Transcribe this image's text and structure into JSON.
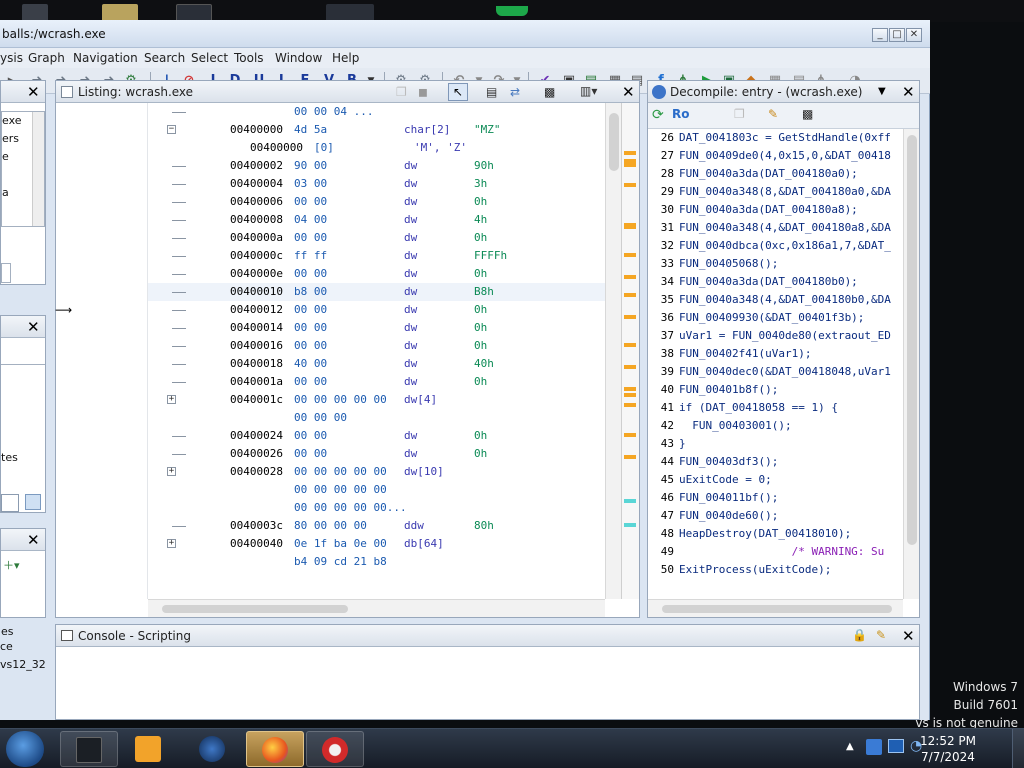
{
  "window": {
    "title": "balls:/wcrash.exe",
    "controls": [
      "_",
      "□",
      "✕"
    ]
  },
  "menu": [
    "ysis",
    "Graph",
    "Navigation",
    "Search",
    "Select",
    "Tools",
    "Window",
    "Help"
  ],
  "toolbar_letters": [
    "I",
    "D",
    "U",
    "L",
    "F",
    "V",
    "B"
  ],
  "left_panels": {
    "top_items": [
      "exe",
      "ers",
      "e",
      "",
      "a"
    ],
    "mid_items": [
      "tes"
    ],
    "bot_items": [
      "es",
      "ce",
      "vs12_32"
    ]
  },
  "listing": {
    "title": "Listing:  wcrash.exe",
    "rows": [
      {
        "addr": "",
        "bytes": "00 00 04 ...",
        "mnem": "",
        "opnd": "",
        "tree": "line"
      },
      {
        "addr": "00400000",
        "bytes": "4d 5a",
        "mnem": "char[2]",
        "opnd": "\"MZ\"",
        "tree": "minus"
      },
      {
        "addr": "00400000",
        "bytes": "[0]",
        "mnem": "'M', 'Z'",
        "opnd": "",
        "tree": "none",
        "indent": true
      },
      {
        "addr": "00400002",
        "bytes": "90 00",
        "mnem": "dw",
        "opnd": "90h",
        "tree": "line"
      },
      {
        "addr": "00400004",
        "bytes": "03 00",
        "mnem": "dw",
        "opnd": "3h",
        "tree": "line"
      },
      {
        "addr": "00400006",
        "bytes": "00 00",
        "mnem": "dw",
        "opnd": "0h",
        "tree": "line"
      },
      {
        "addr": "00400008",
        "bytes": "04 00",
        "mnem": "dw",
        "opnd": "4h",
        "tree": "line"
      },
      {
        "addr": "0040000a",
        "bytes": "00 00",
        "mnem": "dw",
        "opnd": "0h",
        "tree": "line"
      },
      {
        "addr": "0040000c",
        "bytes": "ff ff",
        "mnem": "dw",
        "opnd": "FFFFh",
        "tree": "line"
      },
      {
        "addr": "0040000e",
        "bytes": "00 00",
        "mnem": "dw",
        "opnd": "0h",
        "tree": "line"
      },
      {
        "addr": "00400010",
        "bytes": "b8 00",
        "mnem": "dw",
        "opnd": "B8h",
        "tree": "line",
        "hl": true
      },
      {
        "addr": "00400012",
        "bytes": "00 00",
        "mnem": "dw",
        "opnd": "0h",
        "tree": "line"
      },
      {
        "addr": "00400014",
        "bytes": "00 00",
        "mnem": "dw",
        "opnd": "0h",
        "tree": "line"
      },
      {
        "addr": "00400016",
        "bytes": "00 00",
        "mnem": "dw",
        "opnd": "0h",
        "tree": "line"
      },
      {
        "addr": "00400018",
        "bytes": "40 00",
        "mnem": "dw",
        "opnd": "40h",
        "tree": "line"
      },
      {
        "addr": "0040001a",
        "bytes": "00 00",
        "mnem": "dw",
        "opnd": "0h",
        "tree": "line"
      },
      {
        "addr": "0040001c",
        "bytes": "00 00 00 00 00",
        "mnem": "dw[4]",
        "opnd": "",
        "tree": "plus"
      },
      {
        "addr": "",
        "bytes": "00 00 00",
        "mnem": "",
        "opnd": "",
        "tree": "none"
      },
      {
        "addr": "00400024",
        "bytes": "00 00",
        "mnem": "dw",
        "opnd": "0h",
        "tree": "line"
      },
      {
        "addr": "00400026",
        "bytes": "00 00",
        "mnem": "dw",
        "opnd": "0h",
        "tree": "line"
      },
      {
        "addr": "00400028",
        "bytes": "00 00 00 00 00",
        "mnem": "dw[10]",
        "opnd": "",
        "tree": "plus"
      },
      {
        "addr": "",
        "bytes": "00 00 00 00 00",
        "mnem": "",
        "opnd": "",
        "tree": "none"
      },
      {
        "addr": "",
        "bytes": "00 00 00 00 00...",
        "mnem": "",
        "opnd": "",
        "tree": "none"
      },
      {
        "addr": "0040003c",
        "bytes": "80 00 00 00",
        "mnem": "ddw",
        "opnd": "80h",
        "tree": "line"
      },
      {
        "addr": "00400040",
        "bytes": "0e 1f ba 0e 00",
        "mnem": "db[64]",
        "opnd": "",
        "tree": "plus"
      },
      {
        "addr": "",
        "bytes": "b4 09 cd 21 b8",
        "mnem": "",
        "opnd": "",
        "tree": "none"
      }
    ]
  },
  "decompile": {
    "title": "Decompile: entry -  (wcrash.exe)",
    "lines": [
      {
        "n": "26",
        "code": "DAT_0041803c = GetStdHandle(0xff"
      },
      {
        "n": "27",
        "code": "FUN_00409de0(4,0x15,0,&DAT_00418"
      },
      {
        "n": "28",
        "code": "FUN_0040a3da(DAT_004180a0);"
      },
      {
        "n": "29",
        "code": "FUN_0040a348(8,&DAT_004180a0,&DA"
      },
      {
        "n": "30",
        "code": "FUN_0040a3da(DAT_004180a8);"
      },
      {
        "n": "31",
        "code": "FUN_0040a348(4,&DAT_004180a8,&DA"
      },
      {
        "n": "32",
        "code": "FUN_0040dbca(0xc,0x186a1,7,&DAT_"
      },
      {
        "n": "33",
        "code": "FUN_00405068();"
      },
      {
        "n": "34",
        "code": "FUN_0040a3da(DAT_004180b0);"
      },
      {
        "n": "35",
        "code": "FUN_0040a348(4,&DAT_004180b0,&DA"
      },
      {
        "n": "36",
        "code": "FUN_00409930(&DAT_00401f3b);"
      },
      {
        "n": "37",
        "code": "uVar1 = FUN_0040de80(extraout_ED"
      },
      {
        "n": "38",
        "code": "FUN_00402f41(uVar1);"
      },
      {
        "n": "39",
        "code": "FUN_0040dec0(&DAT_00418048,uVar1"
      },
      {
        "n": "40",
        "code": "FUN_00401b8f();"
      },
      {
        "n": "41",
        "code": "if (DAT_00418058 == 1) {"
      },
      {
        "n": "42",
        "code": "  FUN_00403001();"
      },
      {
        "n": "43",
        "code": "}"
      },
      {
        "n": "44",
        "code": "FUN_00403df3();"
      },
      {
        "n": "45",
        "code": "uExitCode = 0;"
      },
      {
        "n": "46",
        "code": "FUN_004011bf();"
      },
      {
        "n": "47",
        "code": "FUN_0040de60();"
      },
      {
        "n": "48",
        "code": "HeapDestroy(DAT_00418010);"
      },
      {
        "n": "49",
        "code": "                 /* WARNING: Su",
        "comment": true
      },
      {
        "n": "50",
        "code": "ExitProcess(uExitCode);"
      }
    ]
  },
  "console": {
    "title": "Console - Scripting"
  },
  "watermark": {
    "line1": "Windows 7",
    "line2": "Build 7601",
    "line3": "vs is not genuine"
  },
  "taskbar": {
    "time": "12:52 PM",
    "date": "7/7/2024"
  },
  "colors": {
    "accent": "#1b5ab0",
    "panel_bg": "#dbe5f2",
    "marker": "#f5a623"
  }
}
